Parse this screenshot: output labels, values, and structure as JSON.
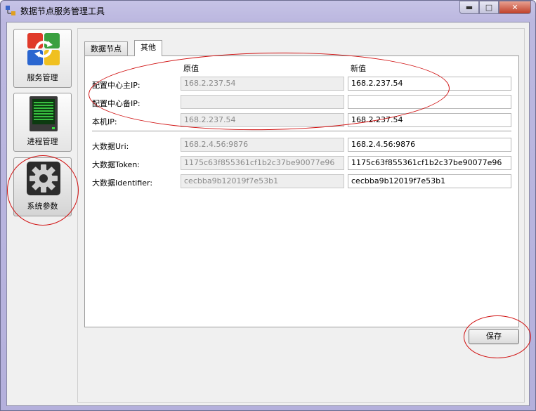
{
  "window": {
    "title": "数据节点服务管理工具",
    "accent_color": "#c6c3e6"
  },
  "caption_buttons": {
    "minimize": "▬",
    "maximize": "□",
    "close": "✕"
  },
  "sidebar": {
    "items": [
      {
        "label": "服务管理",
        "icon": "service-management-icon"
      },
      {
        "label": "进程管理",
        "icon": "process-monitor-icon"
      },
      {
        "label": "系统参数",
        "icon": "gear-icon",
        "selected": true
      }
    ]
  },
  "tabs": [
    {
      "label": "数据节点",
      "active": false
    },
    {
      "label": "其他",
      "active": true
    }
  ],
  "columns": {
    "old": "原值",
    "new": "新值"
  },
  "rows": [
    {
      "label": "配置中心主IP:",
      "old": "168.2.237.54",
      "new": "168.2.237.54"
    },
    {
      "label": "配置中心备IP:",
      "old": "",
      "new": ""
    },
    {
      "label": "本机IP:",
      "old": "168.2.237.54",
      "new": "168.2.237.54"
    },
    {
      "label": "大数据Uri:",
      "old": "168.2.4.56:9876",
      "new": "168.2.4.56:9876"
    },
    {
      "label": "大数据Token:",
      "old": "1175c63f855361cf1b2c37be90077e96",
      "new": "1175c63f855361cf1b2c37be90077e96"
    },
    {
      "label": "大数据Identifier:",
      "old": "cecbba9b12019f7e53b1",
      "new": "cecbba9b12019f7e53b1"
    }
  ],
  "save_button": {
    "label": "保存"
  },
  "annotation_color": "#d01010"
}
